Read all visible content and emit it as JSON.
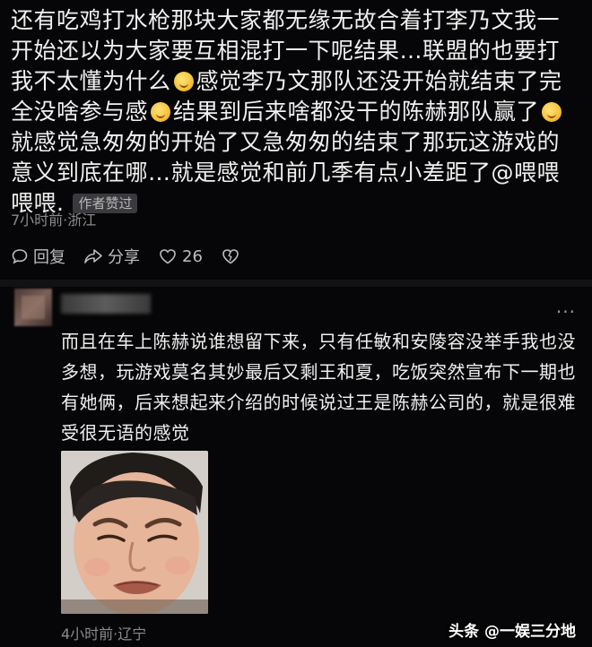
{
  "comment1": {
    "text_part1": "还有吃鸡打水枪那块大家都无缘无故合着打李乃文我一开始还以为大家要互相混打一下呢结果…联盟的也要打我不太懂为什么",
    "text_part2": "感觉李乃文那队还没开始就结束了完全没啥参与感",
    "text_part3": "结果到后来啥都没干的陈赫那队赢了",
    "text_part4": "就感觉急匆匆的开始了又急匆匆的结束了那玩这游戏的意义到底在哪…就是感觉和前几季有点小差距了@喂喂喂喂.",
    "author_liked_badge": "作者赞过",
    "meta": "7小时前·浙江",
    "reply_label": "回复",
    "share_label": "分享",
    "like_count": "26"
  },
  "comment2": {
    "text": "而且在车上陈赫说谁想留下来，只有任敏和安陵容没举手我也没多想，玩游戏莫名其妙最后又剩王和夏，吃饭突然宣布下一期也有她俩，后来想起来介绍的时候说过王是陈赫公司的，就是很难受很无语的感觉",
    "more_icon": "···",
    "meta": "4小时前·辽宁"
  },
  "watermark": "头条 @一娱三分地",
  "icons": {
    "emoji": "smile-emoji-icon",
    "reply": "reply-bubble-icon",
    "share": "share-arrow-icon",
    "like": "heart-icon",
    "dislike": "broken-heart-icon"
  },
  "colors": {
    "background": "#060608",
    "text": "#f0f0f0",
    "meta": "#8b8b8b",
    "badge_bg": "#3a3a3e"
  }
}
